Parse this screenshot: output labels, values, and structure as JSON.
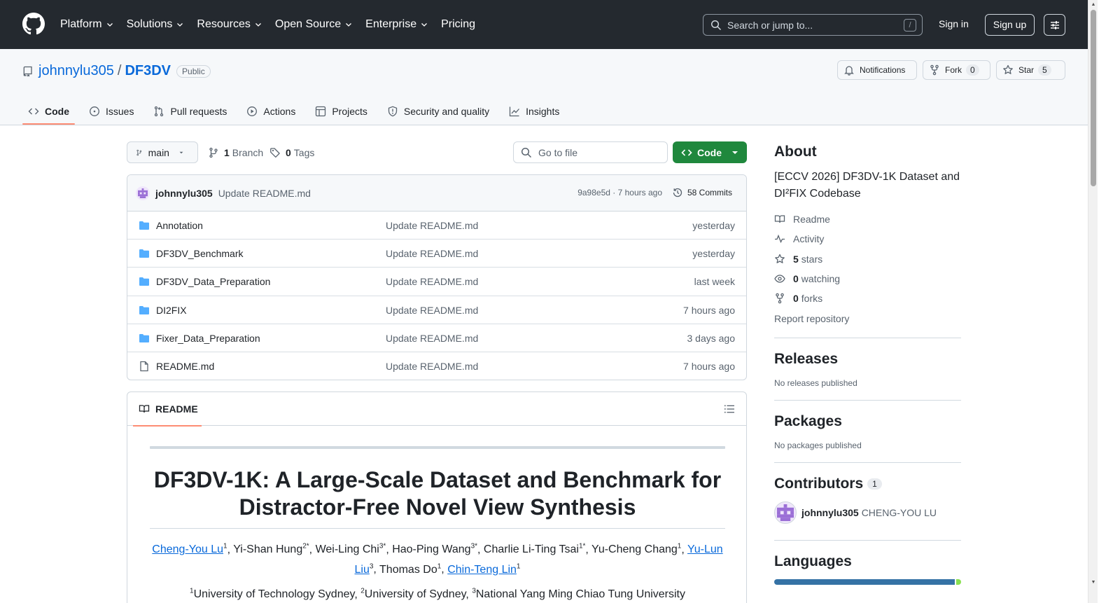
{
  "header": {
    "nav": [
      {
        "label": "Platform",
        "dropdown": true
      },
      {
        "label": "Solutions",
        "dropdown": true
      },
      {
        "label": "Resources",
        "dropdown": true
      },
      {
        "label": "Open Source",
        "dropdown": true
      },
      {
        "label": "Enterprise",
        "dropdown": true
      },
      {
        "label": "Pricing",
        "dropdown": false
      }
    ],
    "search_placeholder": "Search or jump to...",
    "search_shortcut": "/",
    "sign_in": "Sign in",
    "sign_up": "Sign up"
  },
  "repo": {
    "owner": "johnnylu305",
    "separator": "/",
    "name": "DF3DV",
    "visibility": "Public",
    "notifications_label": "Notifications",
    "fork_label": "Fork",
    "fork_count": "0",
    "star_label": "Star",
    "star_count": "5",
    "tabs": [
      {
        "label": "Code",
        "icon": "code-icon",
        "active": true
      },
      {
        "label": "Issues",
        "icon": "issue-icon",
        "active": false
      },
      {
        "label": "Pull requests",
        "icon": "pull-request-icon",
        "active": false
      },
      {
        "label": "Actions",
        "icon": "play-icon",
        "active": false
      },
      {
        "label": "Projects",
        "icon": "table-icon",
        "active": false
      },
      {
        "label": "Security and quality",
        "icon": "shield-icon",
        "active": false
      },
      {
        "label": "Insights",
        "icon": "graph-icon",
        "active": false
      }
    ]
  },
  "toolbar": {
    "branch": "main",
    "branch_count": "1",
    "branch_label": "Branch",
    "tag_count": "0",
    "tag_label": "Tags",
    "goto_placeholder": "Go to file",
    "code_button": "Code"
  },
  "latest_commit": {
    "author": "johnnylu305",
    "message": "Update README.md",
    "hash": "9a98e5d",
    "dot": "·",
    "time": "7 hours ago",
    "commits_label": "58 Commits"
  },
  "files": [
    {
      "type": "folder",
      "name": "Annotation",
      "message": "Update README.md",
      "date": "yesterday"
    },
    {
      "type": "folder",
      "name": "DF3DV_Benchmark",
      "message": "Update README.md",
      "date": "yesterday"
    },
    {
      "type": "folder",
      "name": "DF3DV_Data_Preparation",
      "message": "Update README.md",
      "date": "last week"
    },
    {
      "type": "folder",
      "name": "DI2FIX",
      "message": "Update README.md",
      "date": "7 hours ago"
    },
    {
      "type": "folder",
      "name": "Fixer_Data_Preparation",
      "message": "Update README.md",
      "date": "3 days ago"
    },
    {
      "type": "file",
      "name": "README.md",
      "message": "Update README.md",
      "date": "7 hours ago"
    }
  ],
  "readme": {
    "tab_label": "README",
    "title": "DF3DV-1K: A Large-Scale Dataset and Benchmark for Distractor-Free Novel View Synthesis",
    "authors": [
      {
        "name": "Cheng-You Lu",
        "sup": "1",
        "link": true
      },
      {
        "name": "Yi-Shan Hung",
        "sup": "2*",
        "link": false
      },
      {
        "name": "Wei-Ling Chi",
        "sup": "3*",
        "link": false
      },
      {
        "name": "Hao-Ping Wang",
        "sup": "3*",
        "link": false
      },
      {
        "name": "Charlie Li-Ting Tsai",
        "sup": "1*",
        "link": false
      },
      {
        "name": "Yu-Cheng Chang",
        "sup": "1",
        "link": false
      },
      {
        "name": "Yu-Lun Liu",
        "sup": "3",
        "link": true
      },
      {
        "name": "Thomas Do",
        "sup": "1",
        "link": false
      },
      {
        "name": "Chin-Teng Lin",
        "sup": "1",
        "link": true
      }
    ],
    "affiliations": [
      {
        "sup": "1",
        "name": "University of Technology Sydney"
      },
      {
        "sup": "2",
        "name": "University of Sydney"
      },
      {
        "sup": "3",
        "name": "National Yang Ming Chiao Tung University"
      }
    ]
  },
  "sidebar": {
    "about_title": "About",
    "description": "[ECCV 2026] DF3DV-1K Dataset and DI²FIX Codebase",
    "readme_link": "Readme",
    "activity_link": "Activity",
    "stars_count": "5",
    "stars_label": "stars",
    "watching_count": "0",
    "watching_label": "watching",
    "forks_count": "0",
    "forks_label": "forks",
    "report_link": "Report repository",
    "releases_title": "Releases",
    "releases_empty": "No releases published",
    "packages_title": "Packages",
    "packages_empty": "No packages published",
    "contributors_title": "Contributors",
    "contributors_count": "1",
    "contributor_login": "johnnylu305",
    "contributor_name": "CHENG-YOU LU",
    "languages_title": "Languages",
    "languages": [
      {
        "color": "#3572A5",
        "fraction": 0.975
      },
      {
        "color": "#89e051",
        "fraction": 0.025
      }
    ]
  },
  "colors": {
    "header_bg": "#24292f",
    "link": "#0969da",
    "primary_button": "#1f883d",
    "active_tab_underline": "#fd8c73",
    "folder_icon": "#54aeff"
  }
}
